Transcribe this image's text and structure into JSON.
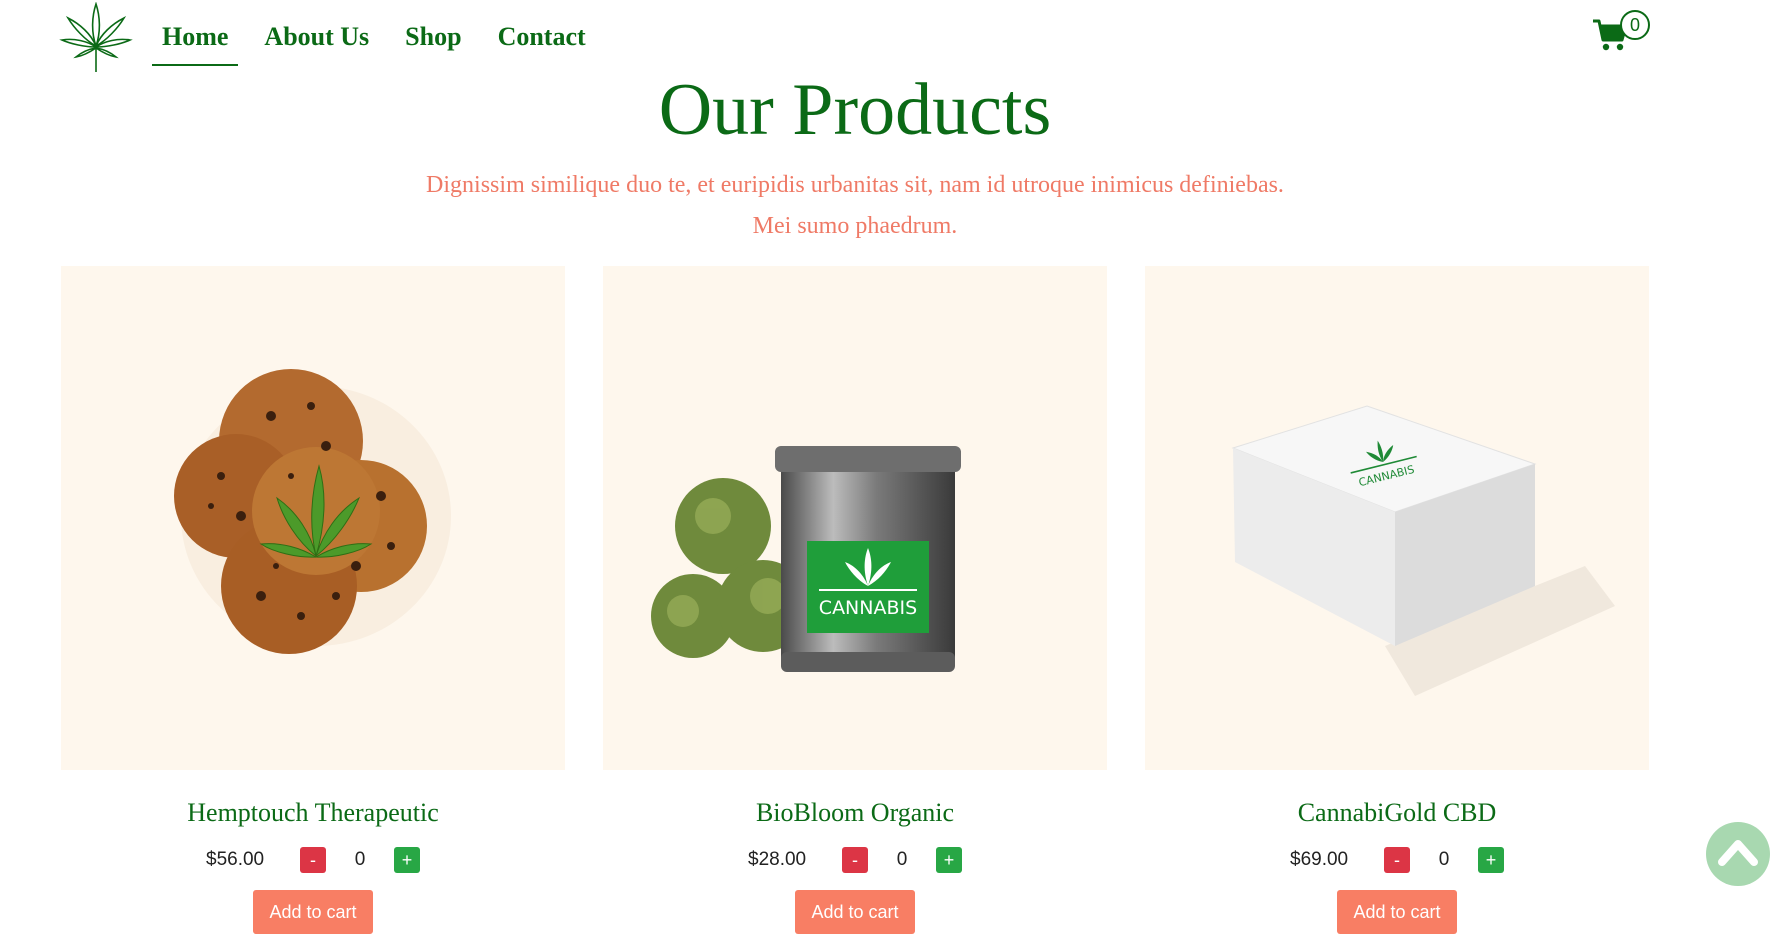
{
  "header": {
    "nav": [
      {
        "label": "Home",
        "active": true
      },
      {
        "label": "About Us",
        "active": false
      },
      {
        "label": "Shop",
        "active": false
      },
      {
        "label": "Contact",
        "active": false
      }
    ],
    "cart": {
      "icon": "cart-icon",
      "count": "0"
    }
  },
  "intro": {
    "title": "Our Products",
    "subtitle": "Dignissim similique duo te, et euripidis urbanitas sit, nam id utroque inimicus definiebas. Mei sumo phaedrum."
  },
  "products": [
    {
      "name": "Hemptouch Therapeutic",
      "price": "$56.00",
      "qty": "0",
      "minus": "-",
      "plus": "+",
      "cta": "Add to cart",
      "image": "cookies-with-leaf"
    },
    {
      "name": "BioBloom Organic",
      "price": "$28.00",
      "qty": "0",
      "minus": "-",
      "plus": "+",
      "cta": "Add to cart",
      "image": "tin-can-with-buds",
      "label_text": "CANNABIS"
    },
    {
      "name": "CannabiGold CBD",
      "price": "$69.00",
      "qty": "0",
      "minus": "-",
      "plus": "+",
      "cta": "Add to cart",
      "image": "white-box",
      "label_text": "CANNABIS"
    }
  ],
  "colors": {
    "brand_green": "#0b6a16",
    "accent_coral": "#f87e64",
    "subtitle_coral": "#ef7a66",
    "card_bg": "#fef7ed",
    "minus_red": "#dc3545",
    "plus_green": "#28a745",
    "scroll_bg": "#a8d8b0"
  },
  "scroll_top": {
    "icon": "chevron-up-icon"
  }
}
